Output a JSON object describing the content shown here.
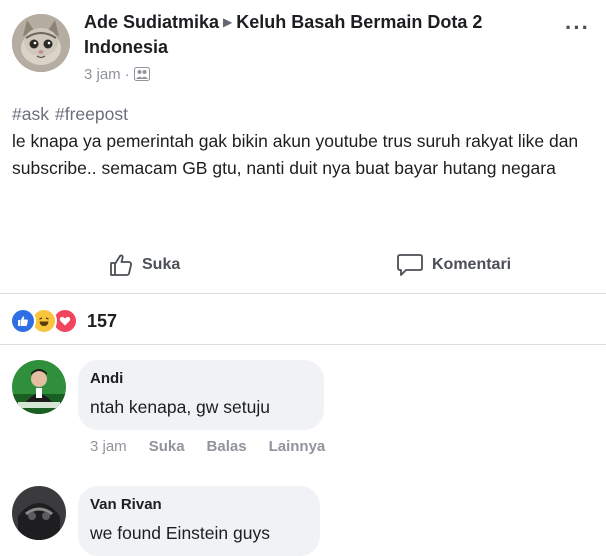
{
  "post": {
    "author": "Ade Sudiatmika",
    "group": "Keluh Basah Bermain Dota 2 Indonesia",
    "time": "3 jam",
    "hashtags": [
      "#ask",
      "#freepost"
    ],
    "body": "le knapa ya pemerintah gak bikin akun youtube trus suruh rakyat like dan subscribe.. semacam GB gtu, nanti duit nya buat bayar hutang negara",
    "more_icon": "···"
  },
  "actions": {
    "like_label": "Suka",
    "comment_label": "Komentari"
  },
  "reactions": {
    "count": "157",
    "types": [
      "like",
      "haha",
      "love"
    ]
  },
  "comments": [
    {
      "name": "Andi",
      "text": "ntah kenapa, gw setuju",
      "time": "3 jam",
      "like_label": "Suka",
      "reply_label": "Balas",
      "more_label": "Lainnya"
    },
    {
      "name": "Van Rivan",
      "text": "we found Einstein guys"
    }
  ],
  "colors": {
    "text": "#1c1e21",
    "muted": "#90949c",
    "like_blue": "#2f6fe4",
    "bubble": "#f0f2f5"
  }
}
